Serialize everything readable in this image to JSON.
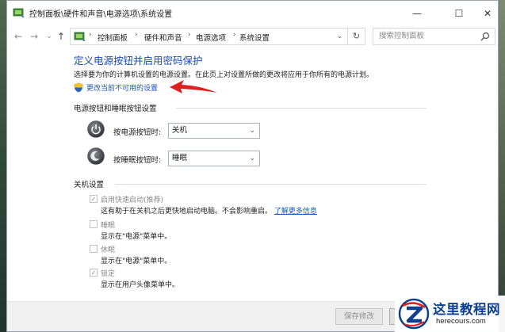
{
  "window": {
    "title": "控制面板\\硬件和声音\\电源选项\\系统设置",
    "minimize": "—",
    "maximize": "☐",
    "close": "✕"
  },
  "nav": {
    "back": "←",
    "forward": "→",
    "recent": "⌄",
    "up": "↑",
    "breadcrumb": [
      "控制面板",
      "硬件和声音",
      "电源选项",
      "系统设置"
    ],
    "separator": "›",
    "dropdown": "⌄",
    "refresh": "↻",
    "search_placeholder": "搜索控制面板"
  },
  "page": {
    "title": "定义电源按钮并启用密码保护",
    "description": "选择要为你的计算机设置的电源设置。在此页上对设置所做的更改将应用于你所有的电源计划。",
    "change_settings_link": "更改当前不可用的设置"
  },
  "power_buttons": {
    "header": "电源按钮和睡眠按钮设置",
    "power_label": "按电源按钮时:",
    "power_value": "关机",
    "sleep_label": "按睡眠按钮时:",
    "sleep_value": "睡眠",
    "chevron": "⌄"
  },
  "shutdown": {
    "header": "关机设置",
    "fast_startup": {
      "label": "启用快速启动(推荐)",
      "checked": true,
      "desc": "这有助于在关机之后更快地启动电脑。不会影响重启。",
      "more_link": "了解更多信息"
    },
    "sleep": {
      "label": "睡眠",
      "checked": false,
      "desc": "显示在\"电源\"菜单中。"
    },
    "hibernate": {
      "label": "休眠",
      "checked": false,
      "desc": "显示在\"电源\"菜单中。"
    },
    "lock": {
      "label": "锁定",
      "checked": true,
      "desc": "显示在用户头像菜单中。"
    },
    "check_mark": "✓"
  },
  "buttons": {
    "save": "保存修改",
    "cancel": "取消"
  },
  "watermark": {
    "title": "这里教程网",
    "url": "herecours.com"
  },
  "colors": {
    "title_blue": "#1a4ba8",
    "link_blue": "#1a55c8",
    "arrow_red": "#e02020",
    "watermark_blue": "#0d3f8f"
  }
}
